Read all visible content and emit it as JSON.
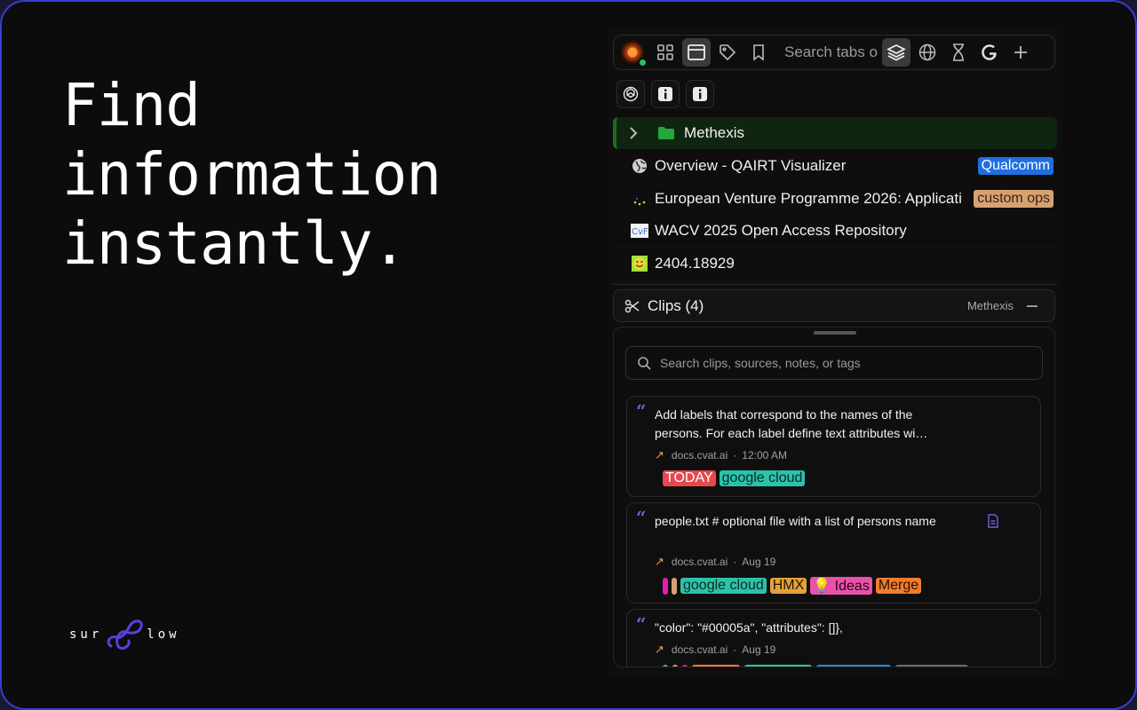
{
  "headline": [
    "Find",
    "information",
    "instantly."
  ],
  "brand": {
    "left": "sur",
    "right": "low"
  },
  "toolbar": {
    "search_placeholder": "Search tabs o",
    "icons": [
      "avatar",
      "grid-icon",
      "window-icon",
      "tag-icon",
      "bookmark-icon",
      "layers-icon",
      "globe-icon",
      "hourglass-icon",
      "google-icon",
      "plus-icon"
    ]
  },
  "pins": [
    "openai-icon",
    "info-icon",
    "info-icon"
  ],
  "group": {
    "label": "Methexis",
    "color": "#22a83a"
  },
  "tabs": [
    {
      "title": "Overview - QAIRT Visualizer",
      "tag": "Qualcomm",
      "tag_color": "#1f6fe0"
    },
    {
      "title": "European Venture Programme 2026: Applicati",
      "tag": "custom ops",
      "tag_color": "#d7a273"
    },
    {
      "title": "WACV 2025 Open Access Repository",
      "tag": "",
      "tag_color": ""
    },
    {
      "title": "2404.18929",
      "tag": "",
      "tag_color": ""
    }
  ],
  "clips": {
    "title": "Clips (4)",
    "source": "Methexis",
    "search_placeholder": "Search clips, sources, notes, or tags",
    "cards": [
      {
        "text": "Add labels that correspond to the names of the persons. For each label define text attributes wi…",
        "domain": "docs.cvat.ai",
        "time": "12:00 AM",
        "tags": [
          {
            "label": "TODAY",
            "color": "#e5484d",
            "text_color": "#ffffff"
          },
          {
            "label": "google cloud",
            "color": "#2bc3a8",
            "text_color": "#0d2a25"
          }
        ]
      },
      {
        "text": "people.txt # optional file with a list of persons name",
        "domain": "docs.cvat.ai",
        "time": "Aug 19",
        "tags": [
          {
            "label": "google cloud",
            "color": "#2bc3a8",
            "text_color": "#0d2a25"
          },
          {
            "label": "HMX",
            "color": "#e5a23b",
            "text_color": "#1f1305"
          },
          {
            "label": "💡 Ideas",
            "color": "#e952a8",
            "text_color": "#2a0418"
          },
          {
            "label": "Merge",
            "color": "#ef7d2e",
            "text_color": "#2a1002"
          }
        ]
      },
      {
        "text": "\"color\": \"#00005a\", \"attributes\": []},",
        "domain": "docs.cvat.ai",
        "time": "Aug 19"
      }
    ]
  },
  "colors": {
    "accent": "#3b3ad6",
    "brand_logo": "#5b3ee0",
    "quote": "#7c5ae0"
  }
}
